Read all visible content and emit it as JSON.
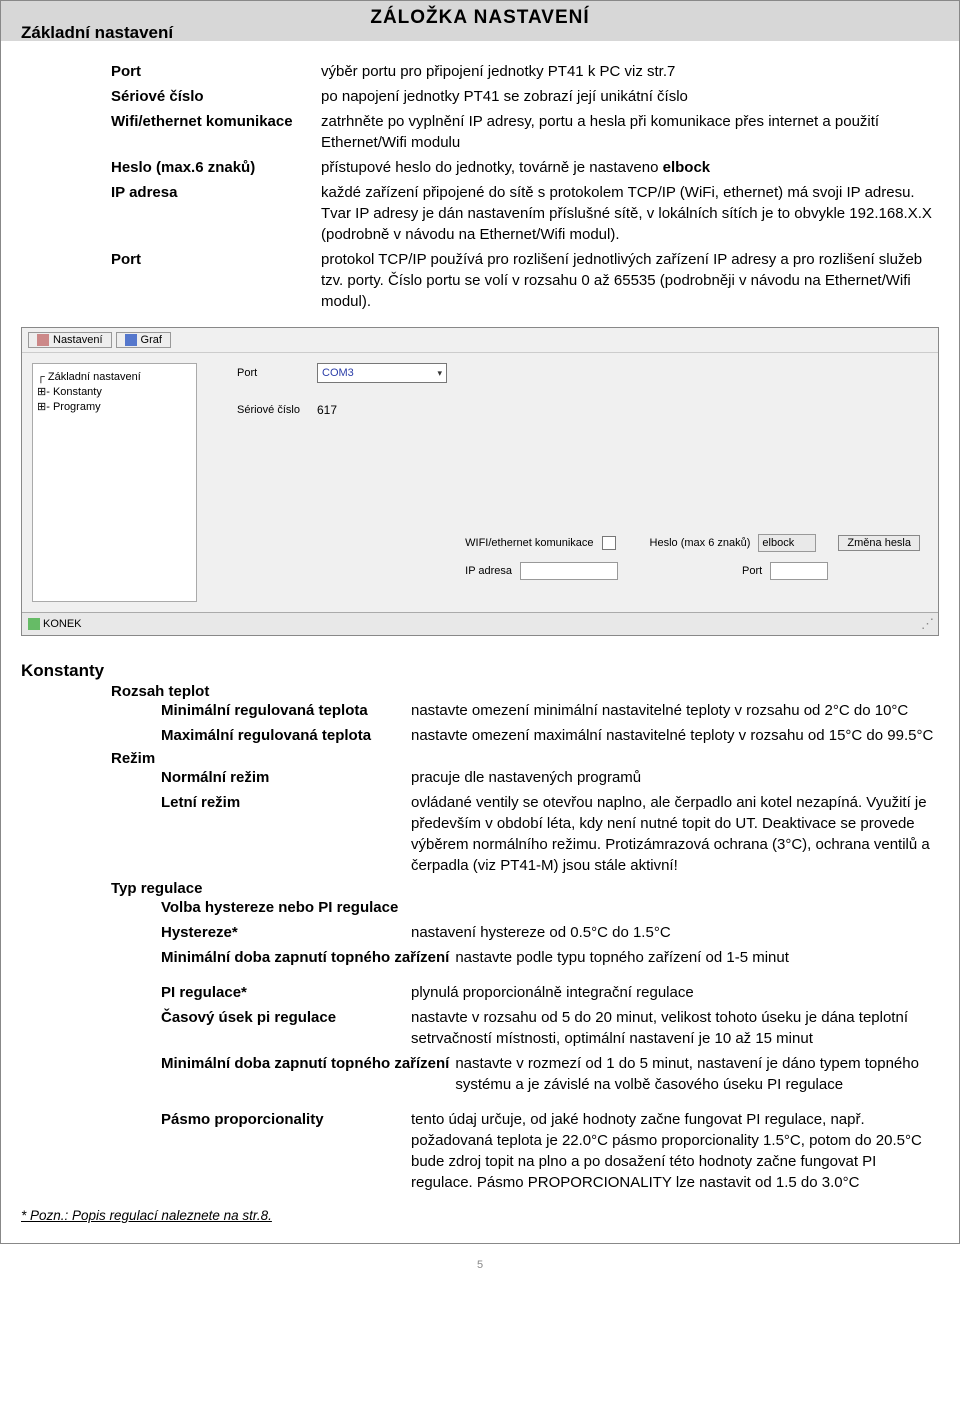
{
  "header": {
    "main_title": "ZÁLOŽKA NASTAVENÍ",
    "basic_title": "Základní nastavení"
  },
  "s1": {
    "port_lbl": "Port",
    "port_desc": "výběr portu pro připojení jednotky PT41 k PC viz str.7",
    "serial_lbl": "Sériové číslo",
    "serial_desc": "po napojení jednotky PT41 se zobrazí její unikátní číslo",
    "wifi_lbl": "Wifi/ethernet komunikace",
    "wifi_desc": "zatrhněte po vyplnění IP adresy, portu a hesla při komunikace přes internet a použití Ethernet/Wifi modulu",
    "pass_lbl": "Heslo (max.6 znaků)",
    "pass_desc": "přístupové heslo do jednotky, továrně je nastaveno elbock",
    "ip_lbl": "IP adresa",
    "ip_desc": "každé zařízení připojené do sítě s protokolem TCP/IP (WiFi, ethernet) má svoji IP adresu. Tvar IP adresy je dán nastavením příslušné sítě, v lokálních sítích je to obvykle 192.168.X.X (podrobně v návodu na Ethernet/Wifi modul).",
    "port2_lbl": "Port",
    "port2_desc": "protokol TCP/IP používá pro rozlišení jednotlivých zařízení IP adresy a pro rozlišení služeb tzv. porty. Číslo portu se volí v rozsahu 0 až 65535 (podrobněji v návodu na Ethernet/Wifi modul)."
  },
  "app": {
    "tab_settings": "Nastavení",
    "tab_graph": "Graf",
    "tree_root": "Základní nastavení",
    "tree_k": "Konstanty",
    "tree_p": "Programy",
    "f_port": "Port",
    "f_port_val": "COM3",
    "f_serial": "Sériové číslo",
    "f_serial_val": "617",
    "f_wifi": "WIFI/ethernet komunikace",
    "f_heslo": "Heslo (max 6 znaků)",
    "f_heslo_val": "elbock",
    "f_zmena": "Změna hesla",
    "f_ip": "IP adresa",
    "f_port2": "Port",
    "status": "KONEK"
  },
  "konstanty": {
    "title": "Konstanty",
    "rozsah_title": "Rozsah teplot",
    "min_lbl": "Minimální regulovaná teplota",
    "min_desc": "nastavte omezení minimální nastavitelné teploty v rozsahu od 2°C do 10°C",
    "max_lbl": "Maximální regulovaná teplota",
    "max_desc": "nastavte omezení maximální nastavitelné teploty v rozsahu od 15°C do 99.5°C",
    "rezim_title": "Režim",
    "norm_lbl": "Normální režim",
    "norm_desc": "pracuje dle nastavených programů",
    "letni_lbl": "Letní režim",
    "letni_desc": "ovládané ventily se otevřou naplno, ale čerpadlo ani kotel nezapíná. Využití je především v období léta, kdy není nutné topit do UT. Deaktivace se provede výběrem normálního režimu. Protizámrazová ochrana (3°C), ochrana ventilů a čerpadla (viz PT41-M) jsou stále aktivní!",
    "typ_title": "Typ regulace",
    "volba_lbl": "Volba hystereze nebo PI regulace",
    "hyst_lbl": "Hystereze*",
    "hyst_desc": "nastavení hystereze od 0.5°C do 1.5°C",
    "mindoba1_lbl": "Minimální doba zapnutí topného zařízení",
    "mindoba1_desc": "nastavte podle typu topného zařízení od 1-5 minut",
    "pi_lbl": "PI regulace*",
    "pi_desc": "plynulá proporcionálně integrační regulace",
    "cas_lbl": "Časový úsek pi regulace",
    "cas_desc": "nastavte v rozsahu od 5 do 20 minut, velikost tohoto úseku je dána teplotní setrvačností místnosti, optimální nastavení je 10 až 15 minut",
    "mindoba2_lbl": "Minimální doba zapnutí topného zařízení",
    "mindoba2_desc": "nastavte v rozmezí od 1 do 5 minut, nastavení je dáno typem topného systému a je závislé na volbě časového úseku PI regulace",
    "pasmo_lbl": "Pásmo proporcionality",
    "pasmo_desc": "tento údaj určuje, od jaké hodnoty začne fungovat PI regulace, např. požadovaná teplota je 22.0°C pásmo proporcionality 1.5°C, potom do 20.5°C bude zdroj topit na plno a po dosažení této hodnoty začne fungovat PI regulace. Pásmo PROPORCIONALITY lze nastavit od 1.5 do 3.0°C"
  },
  "footnote": "* Pozn.: Popis regulací naleznete na str.8.",
  "page_num": "5"
}
